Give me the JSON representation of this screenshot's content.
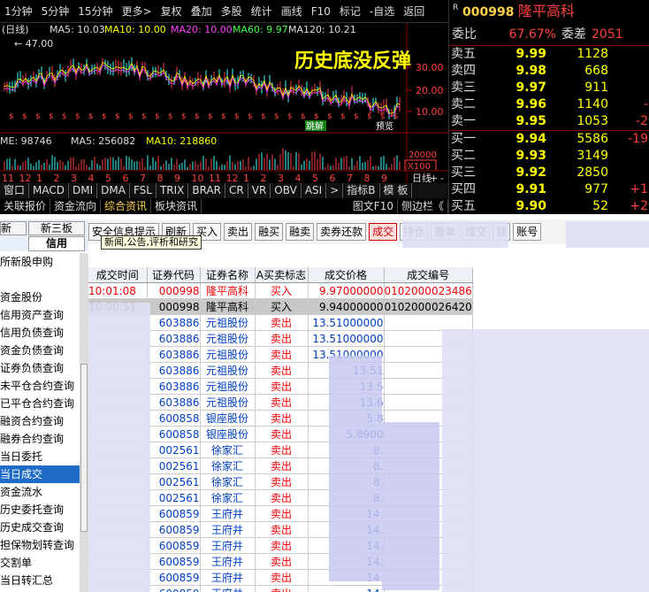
{
  "toolbar": {
    "items": [
      "1分钟",
      "5分钟",
      "15分钟",
      "更多>",
      "复权",
      "叠加",
      "多股",
      "统计",
      "画线",
      "F10",
      "标记",
      "-自选",
      "返回"
    ]
  },
  "chart": {
    "line_label": "(日线)",
    "ma5": "MA5: 10.03",
    "ma10": "MA10: 10.00",
    "ma20": "MA20: 10.00",
    "ma60": "MA60: 9.97",
    "ma120": "MA120: 10.21",
    "high_label": "47.00",
    "overlay_title": "历史底没反弹",
    "y_ticks": [
      "30.00",
      "20.00",
      "10.00"
    ],
    "vol_info": {
      "vol": "ME: 98746",
      "ma5": "MA5: 256082",
      "ma10": "MA10: 218860"
    },
    "vol_ticks": [
      "20000",
      "X100"
    ],
    "axis_labels": [
      "11",
      "12",
      "1",
      "2",
      "3",
      "4",
      "5",
      "6",
      "7",
      "8",
      "9",
      "10",
      "11",
      "12",
      "1",
      "2",
      "3",
      "4",
      "5",
      "6",
      "7",
      "8",
      "9"
    ],
    "axis_right": [
      "日线",
      "+",
      "-"
    ],
    "badges": [
      "跳解",
      "预览"
    ]
  },
  "bottom_tabs": [
    "窗口",
    "MACD",
    "DMI",
    "DMA",
    "FSL",
    "TRIX",
    "BRAR",
    "CR",
    "VR",
    "OBV",
    "ASI",
    ">",
    "指标B",
    "模 板"
  ],
  "info_tabs": [
    "关联报价",
    "资金流向",
    "综合资讯",
    "板块资讯",
    "图文F10",
    "侧边栏《"
  ],
  "stock": {
    "code": "000998",
    "name": "隆平高科",
    "weibi_label": "委比",
    "weibi_value": "67.67%",
    "weicha_label": "委差",
    "weicha_value": "2051"
  },
  "sell": [
    {
      "label": "卖五",
      "price": "9.99",
      "vol": "1128",
      "chg": ""
    },
    {
      "label": "卖四",
      "price": "9.98",
      "vol": "668",
      "chg": ""
    },
    {
      "label": "卖三",
      "price": "9.97",
      "vol": "911",
      "chg": ""
    },
    {
      "label": "卖二",
      "price": "9.96",
      "vol": "1140",
      "chg": "-"
    },
    {
      "label": "卖一",
      "price": "9.95",
      "vol": "1053",
      "chg": "-2"
    }
  ],
  "buy": [
    {
      "label": "买一",
      "price": "9.94",
      "vol": "5586",
      "chg": "-19"
    },
    {
      "label": "买二",
      "price": "9.93",
      "vol": "3149",
      "chg": ""
    },
    {
      "label": "买三",
      "price": "9.92",
      "vol": "2850",
      "chg": ""
    },
    {
      "label": "买四",
      "price": "9.91",
      "vol": "977",
      "chg": "+1"
    },
    {
      "label": "买五",
      "price": "9.90",
      "vol": "52",
      "chg": "+2"
    }
  ],
  "left_tabs": {
    "tab1": "新三板",
    "tab2": "信用",
    "tab0": "新"
  },
  "sidebar": [
    "所新股申购",
    "",
    "资金股份",
    "信用资产查询",
    "信用负债查询",
    "资金负债查询",
    "证券负债查询",
    "未平仓合约查询",
    "已平仓合约查询",
    "融资合约查询",
    "融券合约查询",
    "当日委托",
    "当日成交",
    "资金流水",
    "历史委托查询",
    "历史成交查询",
    "担保物划转查询",
    "交割单",
    "当日转汇总"
  ],
  "sidebar_selected": 12,
  "actions": [
    "安全信息提示",
    "刷新",
    "买入",
    "卖出",
    "融买",
    "融卖",
    "卖券还款",
    "成交",
    "持仓",
    "撤单",
    "成交",
    "锁",
    "账号"
  ],
  "tooltip": "新闻,公告,评析和研究",
  "table": {
    "headers": [
      "成交时间",
      "证券代码",
      "证券名称",
      "A买卖标志",
      "成交价格",
      "成交编号"
    ],
    "rows": [
      [
        "10:01:08",
        "000998",
        "隆平高科",
        "买入",
        "9.97000000",
        "0102000023486"
      ],
      [
        "10:00:51",
        "000998",
        "隆平高科",
        "买入",
        "9.94000000",
        "0102000026420"
      ],
      [
        "",
        "603886",
        "元祖股份",
        "卖出",
        "13.51000000",
        ""
      ],
      [
        "",
        "603886",
        "元祖股份",
        "卖出",
        "13.51000000",
        ""
      ],
      [
        "",
        "603886",
        "元祖股份",
        "卖出",
        "13.51000000",
        ""
      ],
      [
        "",
        "603886",
        "元祖股份",
        "卖出",
        "13.51",
        ""
      ],
      [
        "",
        "603886",
        "元祖股份",
        "卖出",
        "13.5",
        ""
      ],
      [
        "",
        "603886",
        "元祖股份",
        "卖出",
        "13.6",
        ""
      ],
      [
        "",
        "600858",
        "银座股份",
        "卖出",
        "5.8",
        ""
      ],
      [
        "",
        "600858",
        "银座股份",
        "卖出",
        "5.8900",
        ""
      ],
      [
        "",
        "002561",
        "徐家汇",
        "卖出",
        "8.",
        ""
      ],
      [
        "",
        "002561",
        "徐家汇",
        "卖出",
        "8.",
        ""
      ],
      [
        "",
        "002561",
        "徐家汇",
        "卖出",
        "8.",
        ""
      ],
      [
        "",
        "002561",
        "徐家汇",
        "卖出",
        "8.",
        ""
      ],
      [
        "",
        "600859",
        "王府井",
        "卖出",
        "14.",
        ""
      ],
      [
        "",
        "600859",
        "王府井",
        "卖出",
        "14.",
        ""
      ],
      [
        "",
        "600859",
        "王府井",
        "卖出",
        "14.",
        ""
      ],
      [
        "",
        "600859",
        "王府井",
        "卖出",
        "14.",
        ""
      ],
      [
        "",
        "600859",
        "王府井",
        "卖出",
        "14.",
        ""
      ],
      [
        "",
        "600859",
        "王府井",
        "卖出",
        "14.",
        ""
      ]
    ]
  }
}
